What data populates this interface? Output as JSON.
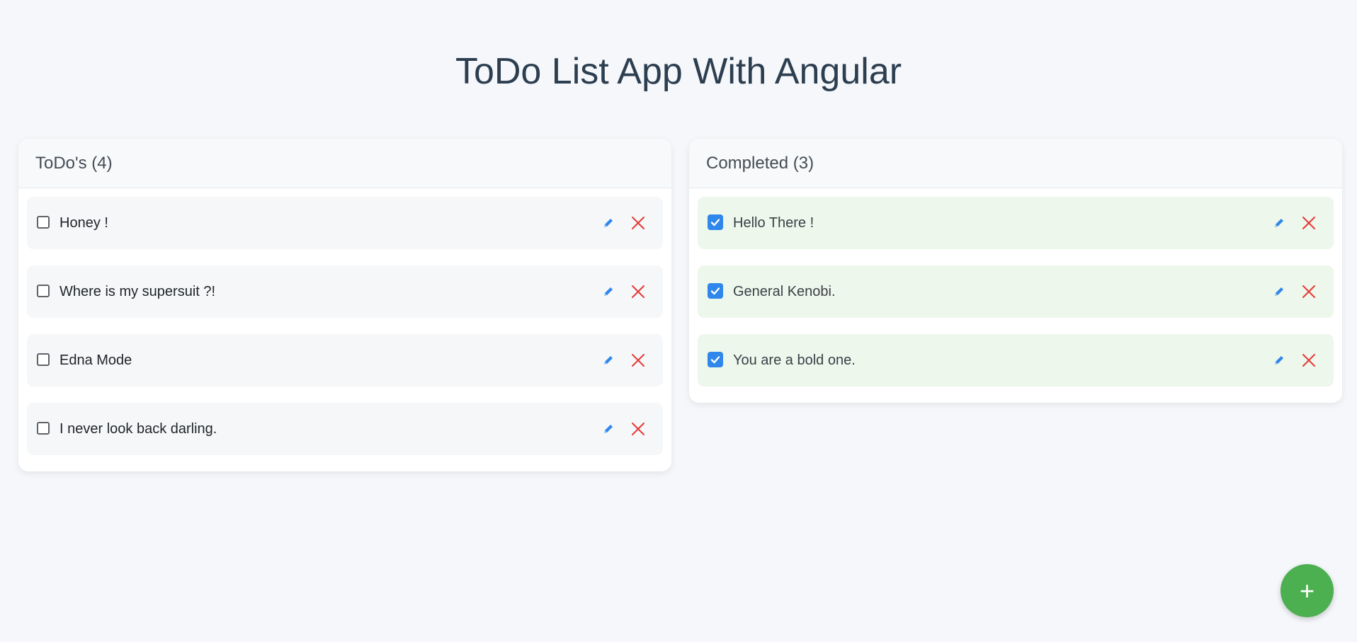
{
  "app": {
    "title": "ToDo List App With Angular"
  },
  "todo_panel": {
    "header": "ToDo's (4)",
    "items": [
      {
        "label": "Honey !",
        "checked": false
      },
      {
        "label": "Where is my supersuit ?!",
        "checked": false
      },
      {
        "label": "Edna Mode",
        "checked": false
      },
      {
        "label": "I never look back darling.",
        "checked": false
      }
    ]
  },
  "completed_panel": {
    "header": "Completed (3)",
    "items": [
      {
        "label": "Hello There !",
        "checked": true
      },
      {
        "label": "General Kenobi.",
        "checked": true
      },
      {
        "label": "You are a bold one.",
        "checked": true
      }
    ]
  },
  "fab": {
    "label": "+"
  },
  "icons": {
    "edit": "pencil-icon",
    "delete": "close-icon",
    "check": "check-icon"
  },
  "colors": {
    "background": "#f5f7fa",
    "title": "#2c3e50",
    "edit_icon": "#2f86eb",
    "delete_icon": "#e53935",
    "checkbox_checked": "#2f86eb",
    "completed_item_bg": "#edf7ec",
    "fab": "#4caf50"
  }
}
